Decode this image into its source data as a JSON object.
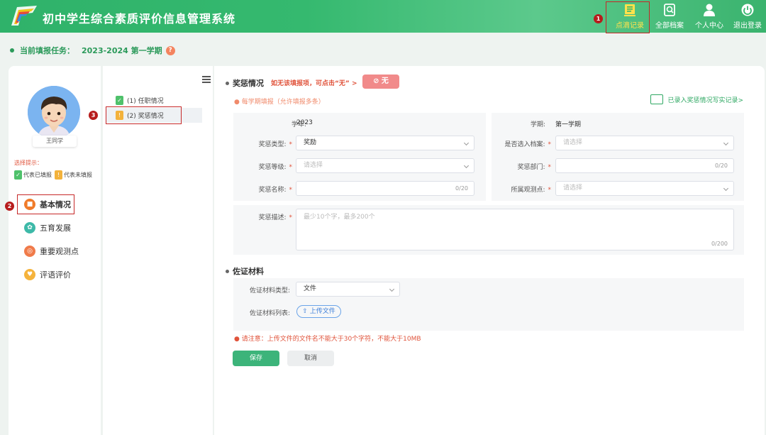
{
  "header": {
    "title": "初中学生综合素质评价信息管理系统",
    "nav": [
      {
        "label": "点滴记录",
        "icon": "notebook-icon",
        "active": true
      },
      {
        "label": "全部档案",
        "icon": "archive-search-icon",
        "active": false
      },
      {
        "label": "个人中心",
        "icon": "user-icon",
        "active": false
      },
      {
        "label": "退出登录",
        "icon": "power-icon",
        "active": false
      }
    ]
  },
  "steps": [
    "1",
    "2",
    "3"
  ],
  "task": {
    "label": "当前填报任务：",
    "term": "2023-2024 第一学期",
    "help": "?"
  },
  "student": {
    "name": "王同学"
  },
  "legend": {
    "title": "选择提示：",
    "filled_chip": "✓",
    "filled_label": "代表已填报",
    "unfilled_chip": "!",
    "unfilled_label": "代表未填报"
  },
  "menu": [
    {
      "label": "基本情况",
      "icon": "basic-info-icon"
    },
    {
      "label": "五育发展",
      "icon": "five-education-icon"
    },
    {
      "label": "重要观测点",
      "icon": "observation-icon"
    },
    {
      "label": "评语评价",
      "icon": "comment-icon"
    }
  ],
  "tree": [
    {
      "chip": "✓",
      "label": "(1) 任职情况"
    },
    {
      "chip": "!",
      "label": "(2) 奖惩情况"
    }
  ],
  "award": {
    "title": "奖惩情况",
    "hint": "如无该填报项，可点击“无” >",
    "none_button": "⊘ 无",
    "note": "● 每学期填报（允许填报多条）",
    "record_link": "已录入奖惩情况写实记录>",
    "year_label": "学年:",
    "year_value": "2023",
    "term_label": "学期:",
    "term_value": "第一学期",
    "type_label": "奖惩类型:",
    "type_value": "奖励",
    "archive_label": "是否选入档案:",
    "archive_placeholder": "请选择",
    "level_label": "奖惩等级:",
    "level_placeholder": "请选择",
    "dept_label": "奖惩部门:",
    "dept_count": "0/20",
    "name_label": "奖惩名称:",
    "name_count": "0/20",
    "obs_label": "所属观测点:",
    "obs_placeholder": "请选择",
    "desc_label": "奖惩描述:",
    "desc_placeholder": "最少10个字，最多200个",
    "desc_count": "0/200",
    "required_mark": "*"
  },
  "evidence": {
    "title": "佐证材料",
    "type_label": "佐证材料类型:",
    "type_value": "文件",
    "list_label": "佐证材料列表:",
    "upload_label": "⇧ 上传文件",
    "warning": "● 请注意：上传文件的文件名不能大于30个字符，不能大于10MB"
  },
  "buttons": {
    "save": "保存",
    "cancel": "取消"
  },
  "colors": {
    "brand": "#35b96f",
    "accent": "#ffe14d",
    "danger": "#e0533b",
    "save": "#3cb47a"
  }
}
